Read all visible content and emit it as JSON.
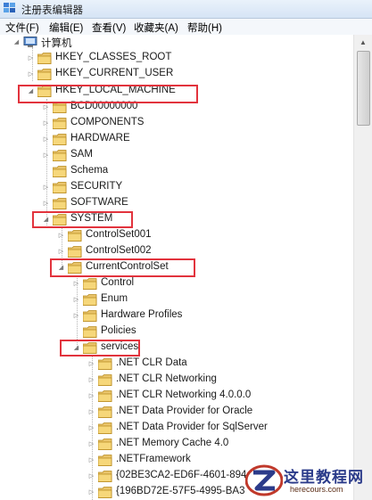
{
  "window": {
    "title": "注册表编辑器"
  },
  "menu": [
    {
      "label": "文件(F)"
    },
    {
      "label": "编辑(E)"
    },
    {
      "label": "查看(V)"
    },
    {
      "label": "收藏夹(A)"
    },
    {
      "label": "帮助(H)"
    }
  ],
  "tree": {
    "root": {
      "label": "计算机"
    },
    "hives": {
      "classes_root": "HKEY_CLASSES_ROOT",
      "current_user": "HKEY_CURRENT_USER",
      "local_machine": "HKEY_LOCAL_MACHINE"
    },
    "hklm_children": {
      "bcd": "BCD00000000",
      "components": "COMPONENTS",
      "hardware": "HARDWARE",
      "sam": "SAM",
      "schema": "Schema",
      "security": "SECURITY",
      "software": "SOFTWARE",
      "system": "SYSTEM"
    },
    "system_children": {
      "cs001": "ControlSet001",
      "cs002": "ControlSet002",
      "ccs": "CurrentControlSet"
    },
    "ccs_children": {
      "control": "Control",
      "enum": "Enum",
      "hwprofiles": "Hardware Profiles",
      "policies": "Policies",
      "services": "services"
    },
    "services_children": {
      "s1": ".NET CLR Data",
      "s2": ".NET CLR Networking",
      "s3": ".NET CLR Networking 4.0.0.0",
      "s4": ".NET Data Provider for Oracle",
      "s5": ".NET Data Provider for SqlServer",
      "s6": ".NET Memory Cache 4.0",
      "s7": ".NETFramework",
      "s8": "{02BE3CA2-ED6F-4601-894",
      "s9": "{196BD72E-57F5-4995-BA3"
    }
  },
  "highlight_color": "#e2333d",
  "watermark": {
    "title": "这里教程网",
    "url": "herecours.com"
  }
}
